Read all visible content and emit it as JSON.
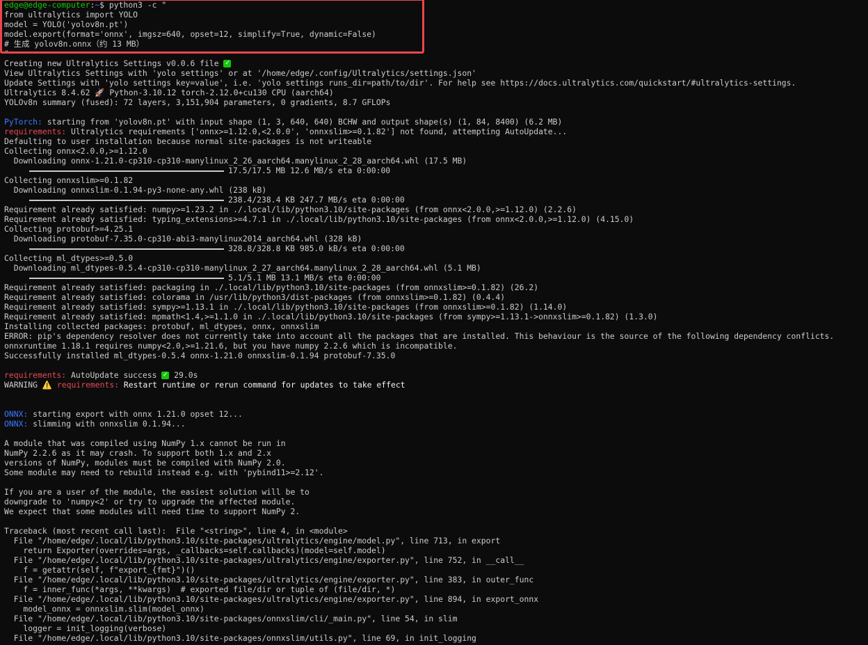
{
  "prompt": {
    "user": "edge@edge-computer",
    "path": "~",
    "symbol": "$",
    "command": " python3 -c \""
  },
  "script_lines": [
    "from ultralytics import YOLO",
    "model = YOLO('yolov8n.pt')",
    "model.export(format='onnx', imgsz=640, opset=12, simplify=True, dynamic=False)",
    "# 生成 yolov8n.onnx（约 13 MB）",
    "\""
  ],
  "settings_created": "Creating new Ultralytics Settings v0.0.6 file ",
  "settings_lines": [
    "View Ultralytics Settings with 'yolo settings' or at '/home/edge/.config/Ultralytics/settings.json'",
    "Update Settings with 'yolo settings key=value', i.e. 'yolo settings runs_dir=path/to/dir'. For help see https://docs.ultralytics.com/quickstart/#ultralytics-settings."
  ],
  "version_pre": "Ultralytics 8.4.62 ",
  "version_post": " Python-3.10.12 torch-2.12.0+cu130 CPU (aarch64)",
  "summary": "YOLOv8n summary (fused): 72 layers, 3,151,904 parameters, 0 gradients, 8.7 GFLOPs",
  "pytorch_label": "PyTorch:",
  "pytorch_text": " starting from 'yolov8n.pt' with input shape (1, 3, 640, 640) BCHW and output shape(s) (1, 84, 8400) (6.2 MB)",
  "req_label": "requirements:",
  "req_text": " Ultralytics requirements ['onnx>=1.12.0,<2.0.0', 'onnxslim>=0.1.82'] not found, attempting AutoUpdate...",
  "pip_lines_a": [
    "Defaulting to user installation because normal site-packages is not writeable",
    "Collecting onnx<2.0.0,>=1.12.0",
    "  Downloading onnx-1.21.0-cp310-cp310-manylinux_2_26_aarch64.manylinux_2_28_aarch64.whl (17.5 MB)"
  ],
  "bar1": "17.5/17.5 MB 12.6 MB/s eta 0:00:00",
  "pip_lines_b": [
    "Collecting onnxslim>=0.1.82",
    "  Downloading onnxslim-0.1.94-py3-none-any.whl (238 kB)"
  ],
  "bar2": "238.4/238.4 KB 247.7 MB/s eta 0:00:00",
  "pip_lines_c": [
    "Requirement already satisfied: numpy>=1.23.2 in ./.local/lib/python3.10/site-packages (from onnx<2.0.0,>=1.12.0) (2.2.6)",
    "Requirement already satisfied: typing_extensions>=4.7.1 in ./.local/lib/python3.10/site-packages (from onnx<2.0.0,>=1.12.0) (4.15.0)",
    "Collecting protobuf>=4.25.1",
    "  Downloading protobuf-7.35.0-cp310-abi3-manylinux2014_aarch64.whl (328 kB)"
  ],
  "bar3": "328.8/328.8 KB 985.0 kB/s eta 0:00:00",
  "pip_lines_d": [
    "Collecting ml_dtypes>=0.5.0",
    "  Downloading ml_dtypes-0.5.4-cp310-cp310-manylinux_2_27_aarch64.manylinux_2_28_aarch64.whl (5.1 MB)"
  ],
  "bar4": "5.1/5.1 MB 13.1 MB/s eta 0:00:00",
  "pip_lines_e": [
    "Requirement already satisfied: packaging in ./.local/lib/python3.10/site-packages (from onnxslim>=0.1.82) (26.2)",
    "Requirement already satisfied: colorama in /usr/lib/python3/dist-packages (from onnxslim>=0.1.82) (0.4.4)",
    "Requirement already satisfied: sympy>=1.13.1 in ./.local/lib/python3.10/site-packages (from onnxslim>=0.1.82) (1.14.0)",
    "Requirement already satisfied: mpmath<1.4,>=1.1.0 in ./.local/lib/python3.10/site-packages (from sympy>=1.13.1->onnxslim>=0.1.82) (1.3.0)",
    "Installing collected packages: protobuf, ml_dtypes, onnx, onnxslim",
    "ERROR: pip's dependency resolver does not currently take into account all the packages that are installed. This behaviour is the source of the following dependency conflicts.",
    "onnxruntime 1.18.1 requires numpy<2.0,>=1.21.6, but you have numpy 2.2.6 which is incompatible.",
    "Successfully installed ml_dtypes-0.5.4 onnx-1.21.0 onnxslim-0.1.94 protobuf-7.35.0"
  ],
  "autoupdate_text": " AutoUpdate success ",
  "autoupdate_time": " 29.0s",
  "warning_word": "WARNING ",
  "warning_text": " Restart runtime or rerun command for updates to take effect",
  "onnx_label": "ONNX:",
  "onnx_line1": " starting export with onnx 1.21.0 opset 12...",
  "onnx_line2": " slimming with onnxslim 0.1.94...",
  "numpy_warning": [
    "A module that was compiled using NumPy 1.x cannot be run in",
    "NumPy 2.2.6 as it may crash. To support both 1.x and 2.x",
    "versions of NumPy, modules must be compiled with NumPy 2.0.",
    "Some module may need to rebuild instead e.g. with 'pybind11>=2.12'."
  ],
  "numpy_advice": [
    "If you are a user of the module, the easiest solution will be to",
    "downgrade to 'numpy<2' or try to upgrade the affected module.",
    "We expect that some modules will need time to support NumPy 2."
  ],
  "traceback": [
    "Traceback (most recent call last):  File \"<string>\", line 4, in <module>",
    "  File \"/home/edge/.local/lib/python3.10/site-packages/ultralytics/engine/model.py\", line 713, in export",
    "    return Exporter(overrides=args, _callbacks=self.callbacks)(model=self.model)",
    "  File \"/home/edge/.local/lib/python3.10/site-packages/ultralytics/engine/exporter.py\", line 752, in __call__",
    "    f = getattr(self, f\"export_{fmt}\")()",
    "  File \"/home/edge/.local/lib/python3.10/site-packages/ultralytics/engine/exporter.py\", line 383, in outer_func",
    "    f = inner_func(*args, **kwargs)  # exported file/dir or tuple of (file/dir, *)",
    "  File \"/home/edge/.local/lib/python3.10/site-packages/ultralytics/engine/exporter.py\", line 894, in export_onnx",
    "    model_onnx = onnxslim.slim(model_onnx)",
    "  File \"/home/edge/.local/lib/python3.10/site-packages/onnxslim/cli/_main.py\", line 54, in slim",
    "    logger = init_logging(verbose)",
    "  File \"/home/edge/.local/lib/python3.10/site-packages/onnxslim/utils.py\", line 69, in init_logging"
  ]
}
